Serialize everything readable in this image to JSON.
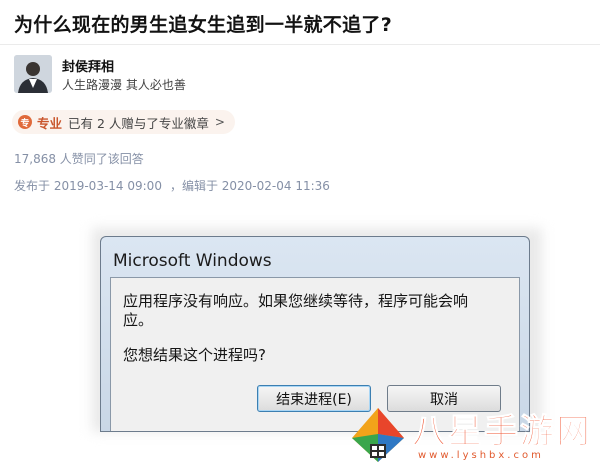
{
  "question": {
    "title": "为什么现在的男生追女生追到一半就不追了?"
  },
  "author": {
    "name": "封侯拜相",
    "bio": "人生路漫漫 其人必也善"
  },
  "badge": {
    "icon_text": "专",
    "strong": "专业",
    "text": "已有 2 人赠与了专业徽章",
    "arrow": ">"
  },
  "stats": {
    "votes": "17,868 人赞同了该回答"
  },
  "dates": {
    "published": "发布于 2019-03-14 09:00",
    "edited": "，编辑于 2020-02-04 11:36"
  },
  "dialog": {
    "title": "Microsoft Windows",
    "message": "应用程序没有响应。如果您继续等待，程序可能会响应。",
    "question": "您想结果这个进程吗?",
    "end_button": "结束进程(E)",
    "cancel_button": "取消"
  },
  "watermark": {
    "brand": "八星手游网",
    "url": "www.lyshbx.com"
  },
  "colors": {
    "accent": "#c9552c",
    "meta": "#8590a6",
    "watermark": "#ef4f2b"
  }
}
